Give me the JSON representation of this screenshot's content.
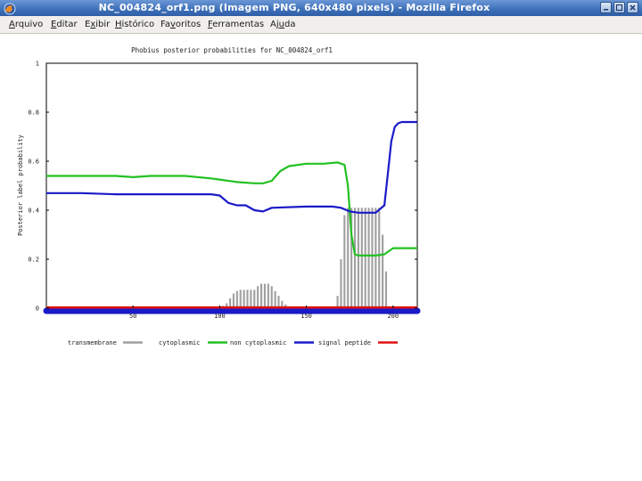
{
  "window": {
    "title": "NC_004824_orf1.png (Imagem PNG, 640x480 pixels) - Mozilla Firefox"
  },
  "menu": {
    "items": [
      {
        "pre": "",
        "ul": "A",
        "post": "rquivo"
      },
      {
        "pre": "",
        "ul": "E",
        "post": "ditar"
      },
      {
        "pre": "E",
        "ul": "x",
        "post": "ibir"
      },
      {
        "pre": "",
        "ul": "H",
        "post": "istórico"
      },
      {
        "pre": "Fa",
        "ul": "v",
        "post": "oritos"
      },
      {
        "pre": "",
        "ul": "F",
        "post": "erramentas"
      },
      {
        "pre": "Aj",
        "ul": "u",
        "post": "da"
      }
    ]
  },
  "colors": {
    "transmembrane": "#a0a0a0",
    "cytoplasmic": "#22c122",
    "non_cytoplasmic": "#1a1ac8",
    "signal_peptide": "#e01010"
  },
  "chart_data": {
    "type": "line",
    "title": "Phobius posterior probabilities for NC_004824_orf1",
    "ylabel": "Posterior label probability",
    "xlabel": "",
    "xlim": [
      0,
      214
    ],
    "ylim": [
      0,
      1
    ],
    "x_ticks": [
      50,
      100,
      150,
      200
    ],
    "y_ticks": [
      {
        "value": 0,
        "label": "0"
      },
      {
        "value": 0.2,
        "label": "0.2"
      },
      {
        "value": 0.4,
        "label": "0.4"
      },
      {
        "value": 0.6,
        "label": "0.6"
      },
      {
        "value": 0.8,
        "label": "0.8"
      },
      {
        "value": 1,
        "label": "1"
      }
    ],
    "legend_position": "bottom",
    "series": [
      {
        "name": "transmembrane",
        "kind": "bars",
        "x": [
          100,
          102,
          104,
          106,
          108,
          110,
          112,
          114,
          116,
          118,
          120,
          122,
          124,
          126,
          128,
          130,
          132,
          134,
          136,
          138,
          140,
          168,
          170,
          172,
          174,
          176,
          178,
          180,
          182,
          184,
          186,
          188,
          190,
          192,
          194,
          196
        ],
        "values": [
          0.005,
          0.01,
          0.02,
          0.04,
          0.06,
          0.07,
          0.075,
          0.075,
          0.075,
          0.075,
          0.075,
          0.09,
          0.1,
          0.1,
          0.1,
          0.09,
          0.07,
          0.05,
          0.03,
          0.015,
          0.005,
          0.05,
          0.2,
          0.38,
          0.41,
          0.41,
          0.41,
          0.41,
          0.41,
          0.41,
          0.41,
          0.41,
          0.41,
          0.41,
          0.3,
          0.15
        ]
      },
      {
        "name": "cytoplasmic",
        "kind": "line",
        "x": [
          0,
          20,
          40,
          50,
          60,
          70,
          80,
          95,
          100,
          110,
          120,
          125,
          130,
          135,
          140,
          150,
          160,
          168,
          172,
          174,
          176,
          178,
          180,
          190,
          195,
          200,
          214
        ],
        "values": [
          0.54,
          0.54,
          0.54,
          0.535,
          0.54,
          0.54,
          0.54,
          0.53,
          0.525,
          0.515,
          0.51,
          0.51,
          0.52,
          0.56,
          0.58,
          0.59,
          0.59,
          0.595,
          0.585,
          0.5,
          0.3,
          0.22,
          0.215,
          0.215,
          0.22,
          0.245,
          0.245
        ]
      },
      {
        "name": "non cytoplasmic",
        "kind": "line",
        "x": [
          0,
          20,
          40,
          50,
          60,
          80,
          95,
          100,
          105,
          110,
          115,
          120,
          125,
          130,
          150,
          165,
          170,
          175,
          180,
          190,
          195,
          197,
          199,
          201,
          203,
          205,
          214
        ],
        "values": [
          0.47,
          0.47,
          0.465,
          0.465,
          0.465,
          0.465,
          0.465,
          0.46,
          0.43,
          0.42,
          0.42,
          0.4,
          0.395,
          0.41,
          0.415,
          0.415,
          0.41,
          0.395,
          0.39,
          0.39,
          0.42,
          0.55,
          0.68,
          0.74,
          0.755,
          0.76,
          0.76
        ]
      },
      {
        "name": "signal peptide",
        "kind": "line",
        "x": [
          0,
          214
        ],
        "values": [
          0.003,
          0.003
        ]
      }
    ]
  }
}
